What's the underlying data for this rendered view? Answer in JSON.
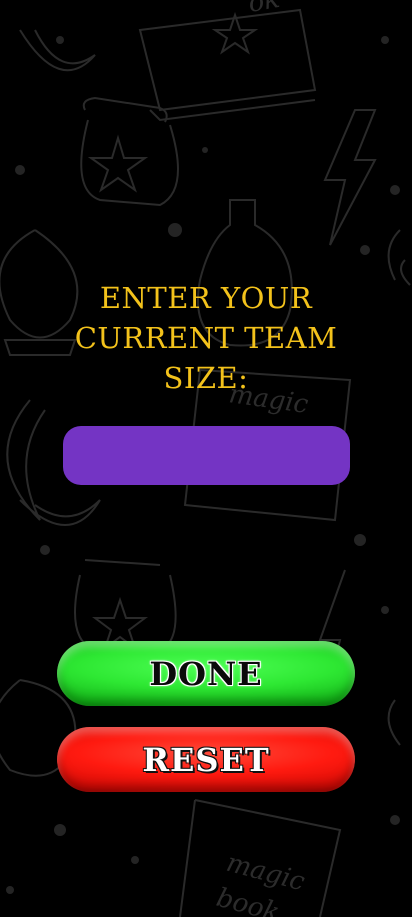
{
  "prompt": {
    "text": "Enter your current team size:"
  },
  "team_size_input": {
    "value": "",
    "placeholder": ""
  },
  "buttons": {
    "done_label": "DONE",
    "reset_label": "RESET"
  },
  "background": {
    "word_1": "magic",
    "word_2": "book",
    "word_3": "ok"
  },
  "colors": {
    "background": "#000000",
    "prompt_text": "#f3c21b",
    "input_fill": "#7434c4",
    "done_button": "#2ee833",
    "reset_button": "#ff1a10"
  }
}
